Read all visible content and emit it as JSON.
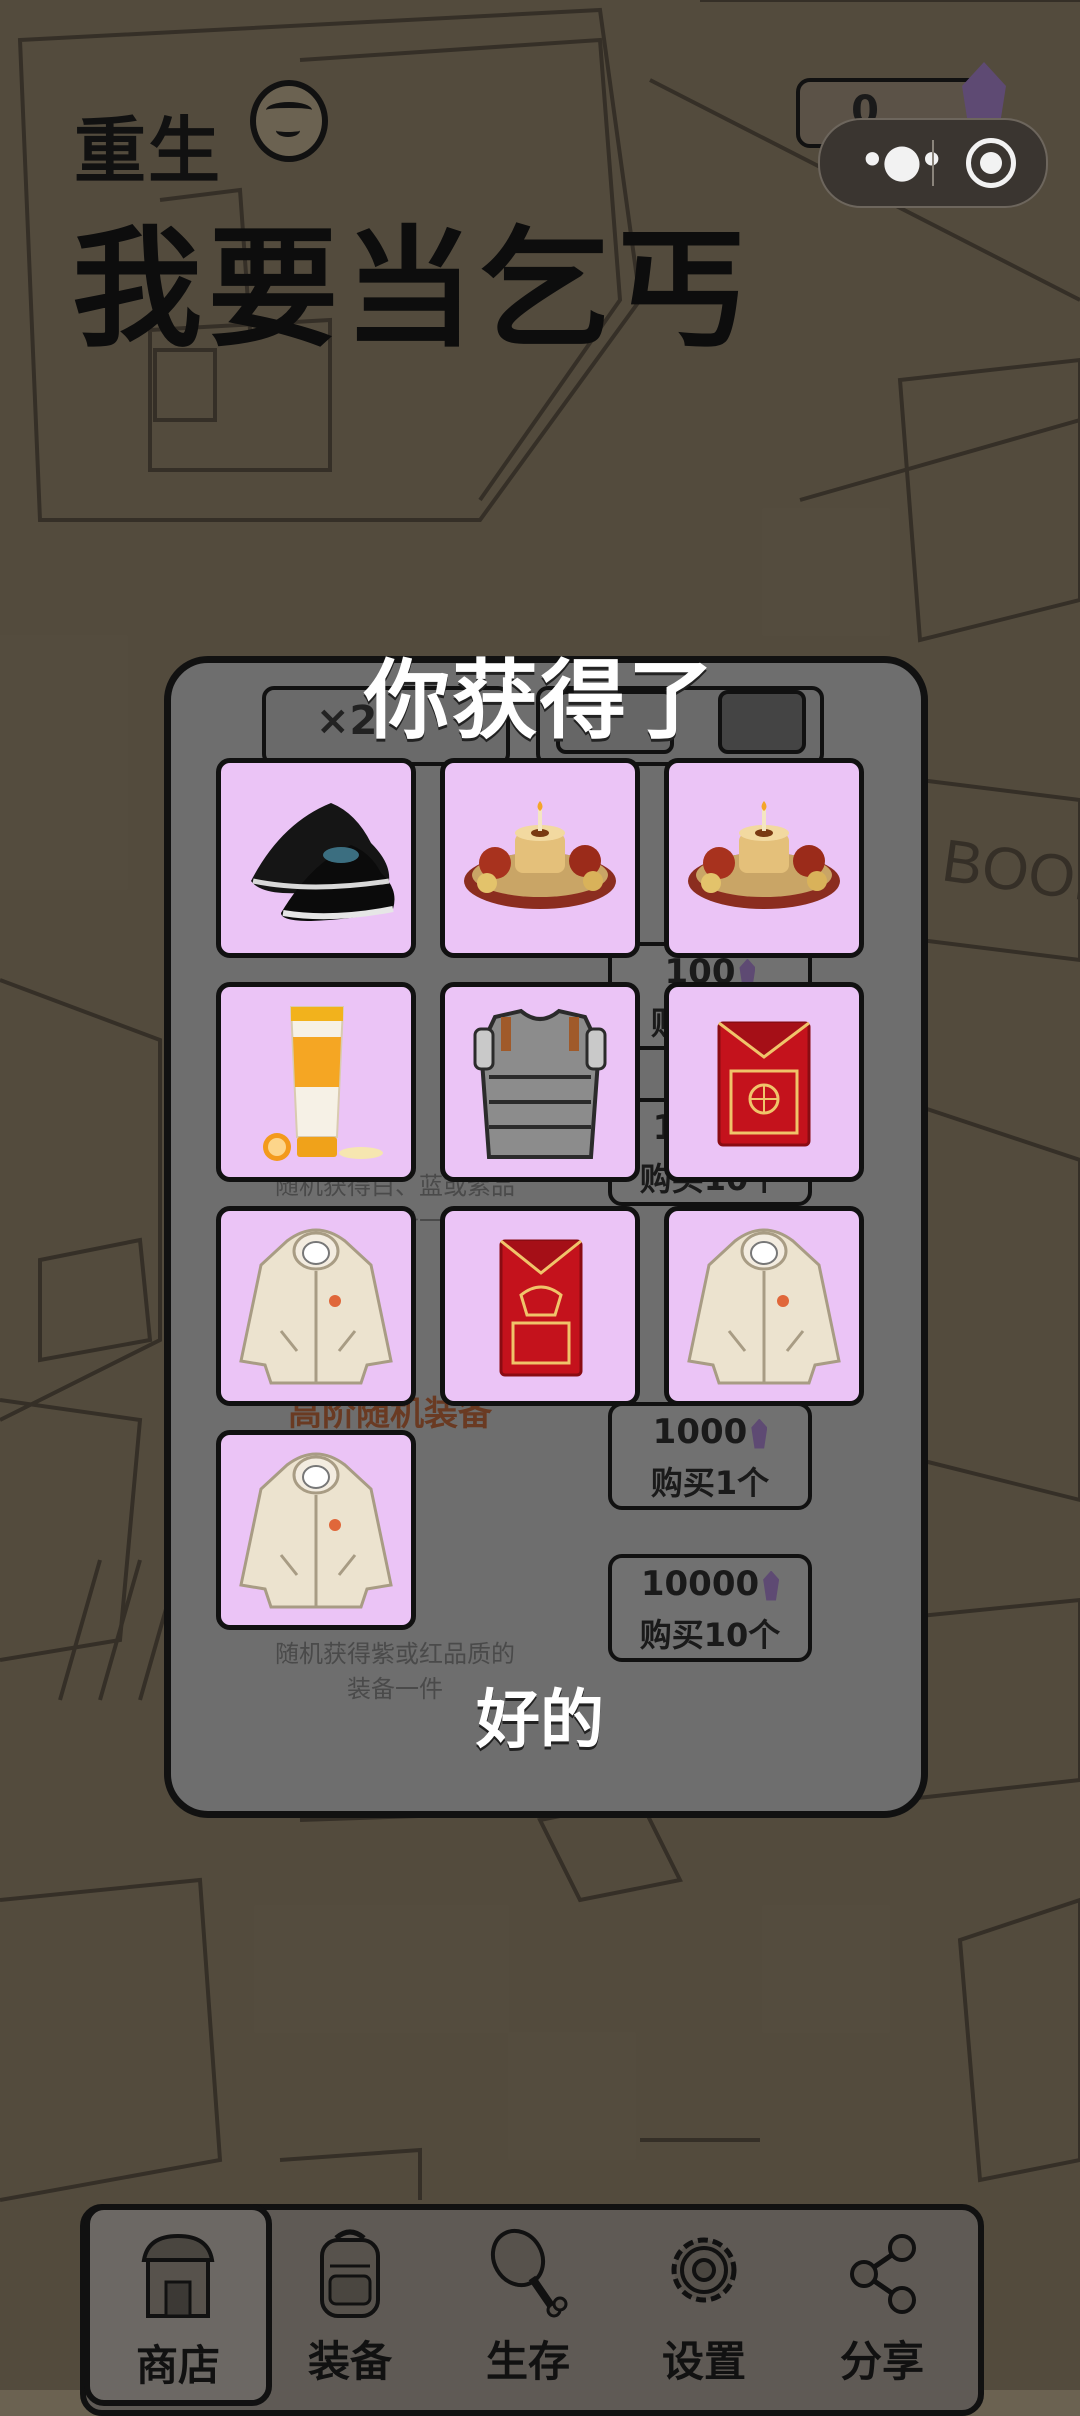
{
  "game": {
    "title_line1": "重生",
    "title_line2": "我要当乞丐"
  },
  "top_bar": {
    "gem_count": "0",
    "capsule_more_icon": "more-dots-icon",
    "capsule_close_icon": "target-close-icon"
  },
  "shop_background": {
    "tab_multiplier": "×2",
    "desc_1": "随机获得白、蓝或紫品质的装备一件",
    "desc_2": "随机获得紫或红品质的装备一件",
    "section_title": "高阶随机装备",
    "btn_1_price": "100",
    "btn_1_label": "购买1个",
    "btn_2_price": "1000",
    "btn_2_label": "购买10个",
    "btn_3_price": "1000",
    "btn_3_label": "购买1个",
    "btn_4_price": "10000",
    "btn_4_label": "购买10个"
  },
  "reward_modal": {
    "title": "你获得了",
    "confirm_label": "好的",
    "items": [
      {
        "icon": "cloth-shoes-icon"
      },
      {
        "icon": "cake-platter-icon"
      },
      {
        "icon": "cake-platter-icon"
      },
      {
        "icon": "sunscreen-tube-icon"
      },
      {
        "icon": "armor-vest-icon"
      },
      {
        "icon": "red-envelope-icon"
      },
      {
        "icon": "hoodie-jacket-icon"
      },
      {
        "icon": "red-envelope-icon"
      },
      {
        "icon": "hoodie-jacket-icon"
      },
      {
        "icon": "hoodie-jacket-icon"
      }
    ]
  },
  "nav": {
    "items": [
      {
        "label": "商店",
        "icon": "shop-icon",
        "active": true
      },
      {
        "label": "装备",
        "icon": "backpack-icon",
        "active": false
      },
      {
        "label": "生存",
        "icon": "drumstick-icon",
        "active": false
      },
      {
        "label": "设置",
        "icon": "gear-icon",
        "active": false
      },
      {
        "label": "分享",
        "icon": "share-icon",
        "active": false
      }
    ]
  },
  "colors": {
    "item_bg": "#ebc4f6",
    "gem": "#5e4a73",
    "background": "#6b6251"
  }
}
